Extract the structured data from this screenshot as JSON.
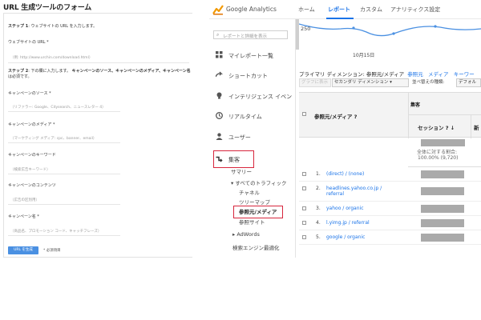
{
  "left_panel": {
    "title": "URL 生成ツールのフォーム",
    "step1_label": "ステップ 1",
    "step1_text": ": ウェブサイトの URL を入力します。",
    "website_url_label": "ウェブサイトの URL *",
    "website_url_placeholder": "（例: http://www.urchin.com/download.html）",
    "step2_label": "ステップ 2",
    "step2_text_a": ": 下の欄に入力します。",
    "step2_text_b": "キャンペーンのソース、キャンペーンのメディア、キャンペーン名",
    "step2_text_c": "は必須です。",
    "fields": [
      {
        "label": "キャンペーンのソース *",
        "placeholder": "（リファラー: Google、Citysearch、ニュースレター 4）"
      },
      {
        "label": "キャンペーンのメディア *",
        "placeholder": "（マーケティング メディア: cpc、banner、email）"
      },
      {
        "label": "キャンペーンのキーワード",
        "placeholder": "（検索広告キーワード）"
      },
      {
        "label": "キャンペーンのコンテンツ",
        "placeholder": "（広告の区別用）"
      },
      {
        "label": "キャンペーン名 *",
        "placeholder": "（商品名、プロモーション コード、キャッチフレーズ）"
      }
    ],
    "generate_button": "URL を生成",
    "required_note": "* 必須項目"
  },
  "ga": {
    "brand": "Google Analytics",
    "tabs": [
      "ホーム",
      "レポート",
      "カスタム",
      "アナリティクス設定"
    ],
    "active_tab": "レポート",
    "search_placeholder": "レポートと詳細を表示",
    "nav": [
      {
        "label": "マイレポート一覧",
        "icon": "grid-icon"
      },
      {
        "label": "ショートカット",
        "icon": "shortcut-icon"
      },
      {
        "label": "インテリジェンス イベン",
        "icon": "lightbulb-icon"
      },
      {
        "label": "リアルタイム",
        "icon": "clock-icon"
      },
      {
        "label": "ユーザー",
        "icon": "user-icon"
      },
      {
        "label": "集客",
        "icon": "acquisition-icon"
      }
    ],
    "sub_nav": {
      "summary": "サマリー",
      "all_traffic": "▾ すべてのトラフィック",
      "channel": "チャネル",
      "treemap": "ツリーマップ",
      "source_medium": "参照元/メディア",
      "referral": "参照サイト",
      "adwords": "▸ AdWords",
      "cut_off": "検索エンジン最適化"
    },
    "chart": {
      "y_label": "250",
      "x_label": "10月15日"
    },
    "primary_dimension": {
      "label": "プライマリ ディメンション:",
      "current": "参照元/メディア",
      "opt1": "参照元",
      "opt2": "メディア",
      "opt3": "キーワー"
    },
    "controls": {
      "graph": "グラフに表示",
      "secondary": "セカンダリ ディメンション ▾",
      "sort_label": "並べ替えの種類:",
      "sort_value": "デフォル"
    },
    "table": {
      "dimension_header": "参照元/メディア ?",
      "group_header": "集客",
      "sessions_header": "セッション ? ↓",
      "next_header": "新",
      "total_pct": "全体に対する割合:",
      "total_value": "100.00% (9,720)",
      "rows": [
        {
          "idx": "1.",
          "label": "(direct) / (none)",
          "label2": ""
        },
        {
          "idx": "2.",
          "label": "headlines.yahoo.co.jp /",
          "label2": "referral"
        },
        {
          "idx": "3.",
          "label": "yahoo / organic",
          "label2": ""
        },
        {
          "idx": "4.",
          "label": "l.yimg.jp / referral",
          "label2": ""
        },
        {
          "idx": "5.",
          "label": "google / organic",
          "label2": ""
        }
      ]
    }
  },
  "colors": {
    "accent": "#1a73e8",
    "highlight": "#d7263d",
    "button": "#4a90e2",
    "chart_line": "#4a90e2"
  }
}
